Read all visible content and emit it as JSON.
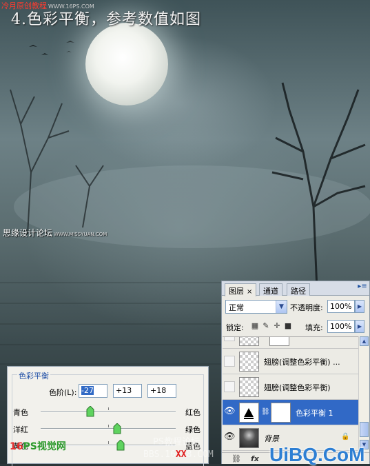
{
  "watermark_top": {
    "text": "冷月原创教程",
    "sub": "WWW.16PS.COM"
  },
  "title": "4.色彩平衡，参考数值如图",
  "watermark_mid": {
    "text": "思缘设计论坛",
    "sub": "WWW.MISSYUAN.COM"
  },
  "color_balance": {
    "title": "色彩平衡",
    "levels_label": "色阶(L):",
    "levels": [
      "-27",
      "+13",
      "+18"
    ],
    "sliders": [
      {
        "left": "青色",
        "right": "红色",
        "value": -27
      },
      {
        "left": "洋红",
        "right": "绿色",
        "value": 13
      },
      {
        "left": "黄色",
        "right": "蓝色",
        "value": 18
      }
    ]
  },
  "layers_panel": {
    "tabs": [
      {
        "label": "图层",
        "close": "×"
      },
      {
        "label": "通道"
      },
      {
        "label": "路径"
      }
    ],
    "blend_mode": "正常",
    "opacity_label": "不透明度:",
    "opacity": "100%",
    "lock_label": "锁定:",
    "fill_label": "填充:",
    "fill": "100%",
    "layers": [
      {
        "name": "",
        "visible": false
      },
      {
        "name": "翅膀(调整色彩平衡) ...",
        "visible": false
      },
      {
        "name": "翅膀(调整色彩平衡)",
        "visible": false
      },
      {
        "name": "色彩平衡 1",
        "visible": true,
        "selected": true
      },
      {
        "name": "背景",
        "visible": true
      }
    ],
    "footer_icons": [
      "link-icon",
      "fx-icon"
    ]
  },
  "watermark_bottom": {
    "logo": "16",
    "text": "PS视觉网",
    "sub": "www.16PS.com"
  },
  "ps_forum": "PS教程论坛",
  "bbs": {
    "pre": "BBS.16",
    "red": "XX",
    "post": "8.COM"
  },
  "uibq": "UiBQ.CoM"
}
